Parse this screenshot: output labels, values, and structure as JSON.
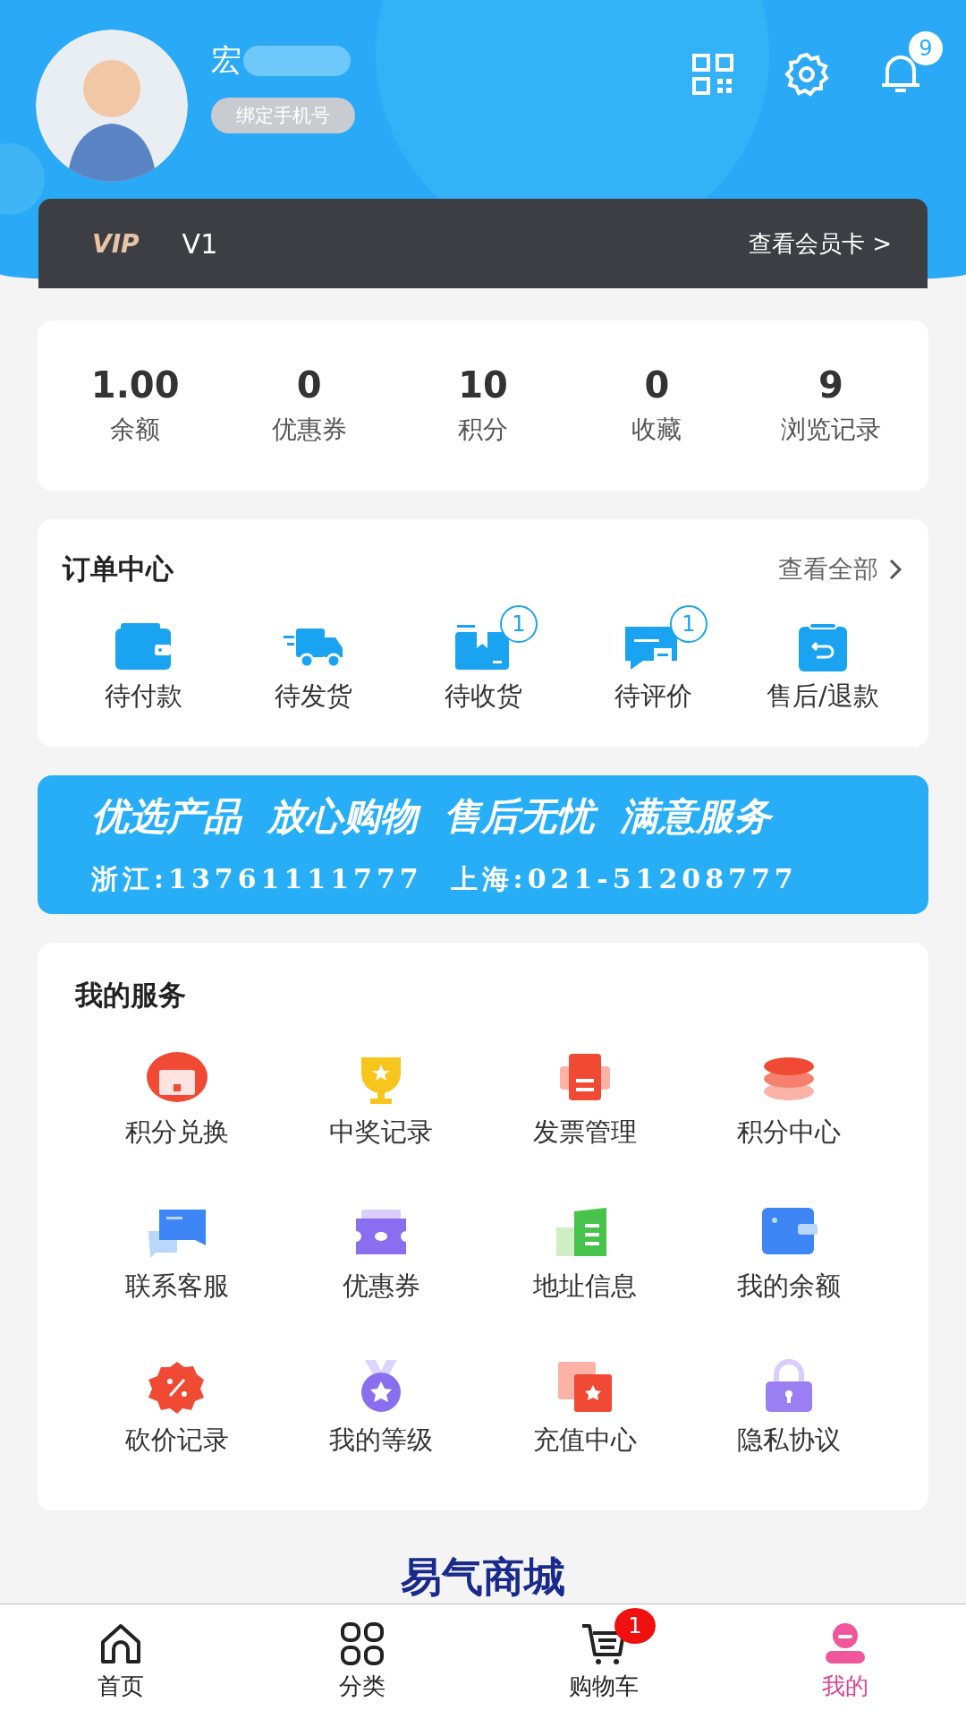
{
  "profile": {
    "name": "宏",
    "bind_phone": "绑定手机号",
    "notification_count": "9"
  },
  "vip": {
    "badge": "VIP",
    "level": "V1",
    "link": "查看会员卡 >"
  },
  "stats": [
    {
      "value": "1.00",
      "label": "余额"
    },
    {
      "value": "0",
      "label": "优惠券"
    },
    {
      "value": "10",
      "label": "积分"
    },
    {
      "value": "0",
      "label": "收藏"
    },
    {
      "value": "9",
      "label": "浏览记录"
    }
  ],
  "orders": {
    "title": "订单中心",
    "link": "查看全部",
    "items": [
      {
        "kind": "wallet",
        "label": "待付款"
      },
      {
        "kind": "truck",
        "label": "待发货"
      },
      {
        "kind": "box",
        "label": "待收货",
        "badge": "1"
      },
      {
        "kind": "chat",
        "label": "待评价",
        "badge": "1"
      },
      {
        "kind": "refund",
        "label": "售后/退款"
      }
    ]
  },
  "banner": {
    "line_1": "优选产品  放心购物  售后无忧  满意服务",
    "line_2": "浙江:13761111777  上海:021-51208777"
  },
  "services": {
    "title": "我的服务",
    "items": [
      {
        "kind": "calendar",
        "label": "积分兑换"
      },
      {
        "kind": "trophy",
        "label": "中奖记录"
      },
      {
        "kind": "printer",
        "label": "发票管理"
      },
      {
        "kind": "coins",
        "label": "积分中心"
      },
      {
        "kind": "chat",
        "label": "联系客服"
      },
      {
        "kind": "ticket",
        "label": "优惠券"
      },
      {
        "kind": "building",
        "label": "地址信息"
      },
      {
        "kind": "wallet",
        "label": "我的余额"
      },
      {
        "kind": "discount",
        "label": "砍价记录"
      },
      {
        "kind": "medal",
        "label": "我的等级"
      },
      {
        "kind": "cards",
        "label": "充值中心"
      },
      {
        "kind": "lock",
        "label": "隐私协议"
      }
    ]
  },
  "footer_logo": "易气商城",
  "tabs": [
    {
      "kind": "home",
      "label": "首页",
      "selected": false
    },
    {
      "kind": "grid",
      "label": "分类",
      "selected": false
    },
    {
      "kind": "cart",
      "label": "购物车",
      "selected": false,
      "badge": "1"
    },
    {
      "kind": "user",
      "label": "我的",
      "selected": true
    }
  ]
}
